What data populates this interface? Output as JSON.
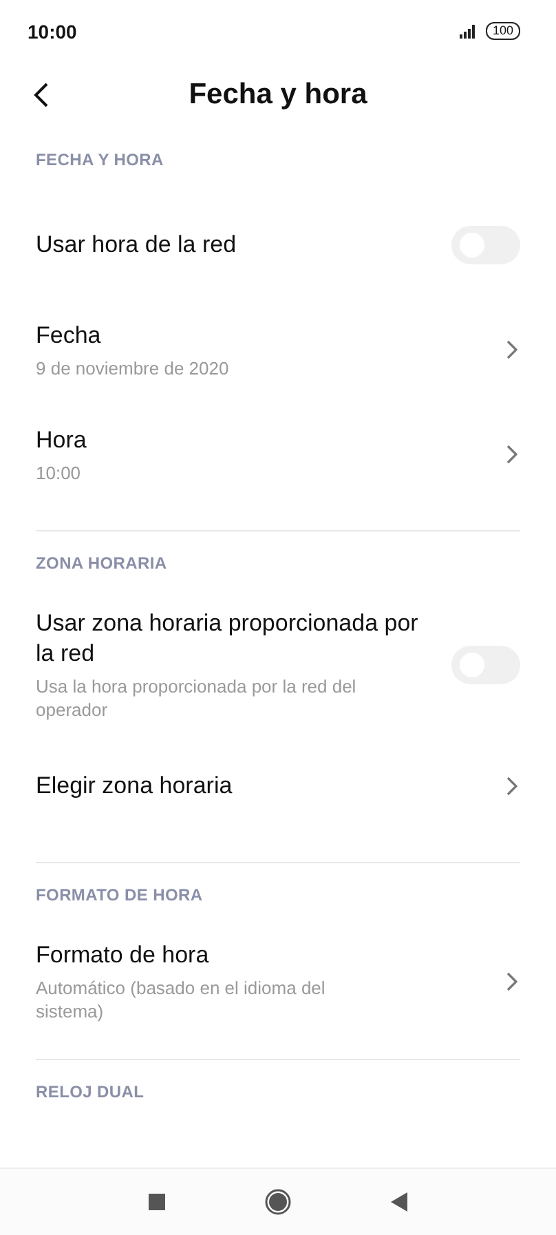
{
  "status_bar": {
    "time": "10:00",
    "battery": "100"
  },
  "header": {
    "title": "Fecha y hora"
  },
  "sections": [
    {
      "title": "FECHA Y HORA",
      "items": [
        {
          "kind": "toggle",
          "label": "Usar hora de la red",
          "on": false
        },
        {
          "kind": "link",
          "label": "Fecha",
          "value": "9 de noviembre de 2020"
        },
        {
          "kind": "link",
          "label": "Hora",
          "value": "10:00"
        }
      ]
    },
    {
      "title": "ZONA HORARIA",
      "items": [
        {
          "kind": "toggle",
          "label": "Usar zona horaria proporcionada por la red",
          "value": "Usa la hora proporcionada por la red del operador",
          "on": false
        },
        {
          "kind": "link",
          "label": "Elegir zona horaria"
        }
      ]
    },
    {
      "title": "FORMATO DE HORA",
      "items": [
        {
          "kind": "link",
          "label": "Formato de hora",
          "value": "Automático (basado en el idioma del sistema)"
        }
      ]
    },
    {
      "title": "RELOJ DUAL"
    }
  ]
}
